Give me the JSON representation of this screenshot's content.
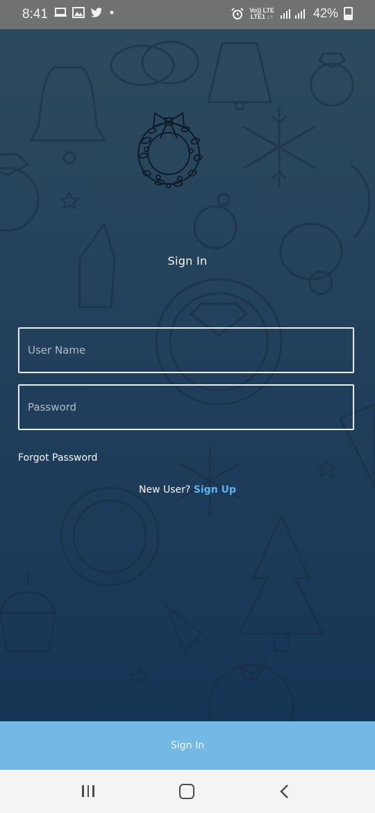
{
  "status_bar": {
    "time": "8:41",
    "network_top": "Vo)) LTE",
    "network_bottom": "LTE1 ↓↑",
    "battery": "42%"
  },
  "screen": {
    "title": "Sign In",
    "username_placeholder": "User Name",
    "password_placeholder": "Password",
    "forgot_password": "Forgot Password",
    "new_user_prefix": "New User? ",
    "sign_up": "Sign Up",
    "sign_in_button": "Sign In"
  },
  "colors": {
    "button": "#74b9e6",
    "link": "#5fb4f0",
    "background_top": "#2d4a5d",
    "background_bottom": "#163556"
  },
  "icons": {
    "status_left": [
      "laptop-icon",
      "gallery-icon",
      "twitter-icon",
      "dot-icon"
    ],
    "status_right": [
      "alarm-icon",
      "signal-icon",
      "battery-icon"
    ],
    "decoration": [
      "wreath-icon",
      "bell-icon",
      "rings-icon",
      "snowflake-icon",
      "ring-icon",
      "champagne-icon",
      "necklace-icon",
      "christmas-tree-icon",
      "cupcake-icon"
    ],
    "nav": [
      "recent-apps-icon",
      "home-icon",
      "back-icon"
    ]
  }
}
